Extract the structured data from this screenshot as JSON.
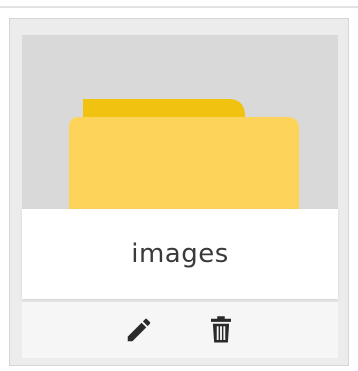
{
  "folder": {
    "name": "images",
    "icon": "folder-icon",
    "icon_colors": {
      "front": "#fdd35a",
      "back": "#f2c210"
    }
  },
  "actions": [
    {
      "name": "edit",
      "icon": "pencil-icon"
    },
    {
      "name": "delete",
      "icon": "trash-icon"
    }
  ],
  "colors": {
    "card_bg": "#ececec",
    "preview_bg": "#d9d9d9",
    "icon_dark": "#2a2a2a"
  }
}
